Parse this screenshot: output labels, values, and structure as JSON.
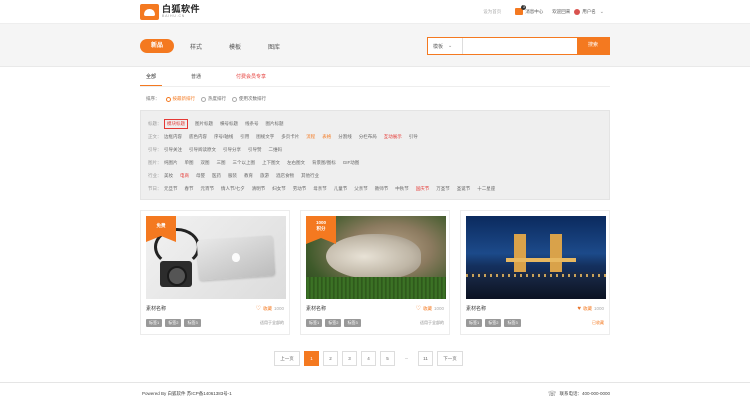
{
  "header": {
    "logo_cn": "白狐软件",
    "logo_en": "BAIHU.CN",
    "set_home": "设为首页",
    "messages": "消息中心",
    "message_count": "3",
    "welcome": "欢迎回来",
    "username": "用户名"
  },
  "nav": {
    "items": [
      "新品",
      "样式",
      "模板",
      "图库"
    ],
    "search_type": "模板",
    "search_placeholder": "",
    "search_button": "搜索"
  },
  "tabs": [
    "全部",
    "普通",
    "付费会员专享"
  ],
  "sort": {
    "label": "排序：",
    "options": [
      "按最新排行",
      "热度排行",
      "使用次数排行"
    ]
  },
  "filters": [
    {
      "label": "标题：",
      "options": [
        "模块标题",
        "图片标题",
        "横号标题",
        "线条号",
        "图片标题"
      ]
    },
    {
      "label": "正文：",
      "options": [
        "边框内容",
        "底色内容",
        "序号/轴线",
        "引用",
        "图规文字",
        "多页卡片",
        "流程",
        "表格",
        "分割线",
        "分栏布局",
        "互动展示",
        "引导"
      ]
    },
    {
      "label": "引导：",
      "options": [
        "引导关注",
        "引导阅读原文",
        "引导分享",
        "引导赞",
        "二维码"
      ]
    },
    {
      "label": "图片：",
      "options": [
        "纯图片",
        "单图",
        "双图",
        "三图",
        "三个以上图",
        "上下图文",
        "左右图文",
        "背景图/图标",
        "GIF动图"
      ]
    },
    {
      "label": "行业：",
      "options": [
        "美妆",
        "电商",
        "母婴",
        "医药",
        "服装",
        "教育",
        "旅游",
        "酒店食物",
        "其他行业"
      ]
    },
    {
      "label": "节日：",
      "options": [
        "元旦节",
        "春节",
        "元宵节",
        "情人节/七夕",
        "清明节",
        "妇女节",
        "劳动节",
        "母亲节",
        "儿童节",
        "父亲节",
        "教师节",
        "中秋节",
        "国庆节",
        "万圣节",
        "圣诞节",
        "十二星座"
      ]
    }
  ],
  "cards": [
    {
      "ribbon": "免费",
      "title": "素材名称",
      "likes_label": "收藏",
      "likes": "1000",
      "tags": [
        "标签1",
        "标签2",
        "标签3"
      ],
      "sub": "适用于全部的"
    },
    {
      "ribbon": "1000\n积分",
      "title": "素材名称",
      "likes_label": "收藏",
      "likes": "1000",
      "tags": [
        "标签1",
        "标签2",
        "标签3"
      ],
      "sub": "适用于全部的"
    },
    {
      "ribbon": "",
      "title": "素材名称",
      "likes_label": "收藏",
      "likes": "1000",
      "tags": [
        "标签1",
        "标签2",
        "标签3"
      ],
      "sub": "已收藏"
    }
  ],
  "pager": {
    "prev": "上一页",
    "pages": [
      "1",
      "2",
      "3",
      "4",
      "5"
    ],
    "ellipsis": "...",
    "last": "11",
    "next": "下一页"
  },
  "footer": {
    "left": "Powered By 白狐软件 苏ICP备14061383号-1",
    "right": "联系电话：400-000-0000"
  },
  "colors": {
    "accent": "#f47920",
    "vip": "#e53935"
  }
}
